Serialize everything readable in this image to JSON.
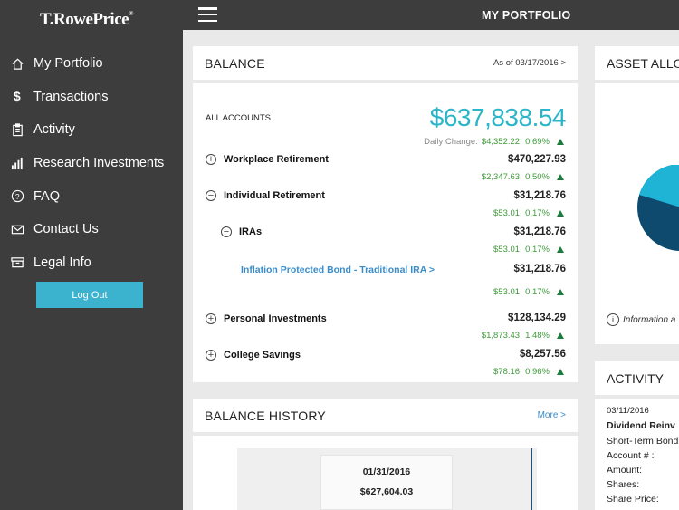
{
  "brand": {
    "name": "T.RowePrice",
    "reg": "®"
  },
  "header": {
    "title": "MY PORTFOLIO"
  },
  "sidebar": {
    "items": [
      {
        "label": "My Portfolio",
        "icon": "home-icon"
      },
      {
        "label": "Transactions",
        "icon": "dollar-icon"
      },
      {
        "label": "Activity",
        "icon": "clipboard-icon"
      },
      {
        "label": "Research Investments",
        "icon": "bar-chart-icon"
      },
      {
        "label": "FAQ",
        "icon": "question-icon"
      },
      {
        "label": "Contact Us",
        "icon": "mail-icon"
      },
      {
        "label": "Legal Info",
        "icon": "archive-icon"
      }
    ],
    "logout_label": "Log Out"
  },
  "balance": {
    "title": "BALANCE",
    "as_of": "As of 03/17/2016 >",
    "all_accounts_label": "ALL ACCOUNTS",
    "total": "$637,838.54",
    "daily_change_label": "Daily Change:",
    "daily_change_value": "$4,352.22",
    "daily_change_pct": "0.69%",
    "rows": [
      {
        "label": "Workplace Retirement",
        "toggle": "+",
        "amount": "$470,227.93",
        "change": "$2,347.63",
        "pct": "0.50%"
      },
      {
        "label": "Individual Retirement",
        "toggle": "−",
        "amount": "$31,218.76",
        "change": "$53.01",
        "pct": "0.17%"
      },
      {
        "label": "IRAs",
        "toggle": "−",
        "amount": "$31,218.76",
        "change": "$53.01",
        "pct": "0.17%"
      },
      {
        "label": "Inflation Protected Bond - Traditional IRA  >",
        "amount": "$31,218.76",
        "change": "$53.01",
        "pct": "0.17%"
      },
      {
        "label": "Personal Investments",
        "toggle": "+",
        "amount": "$128,134.29",
        "change": "$1,873.43",
        "pct": "1.48%"
      },
      {
        "label": "College Savings",
        "toggle": "+",
        "amount": "$8,257.56",
        "change": "$78.16",
        "pct": "0.96%"
      }
    ]
  },
  "balance_history": {
    "title": "BALANCE HISTORY",
    "more": "More >",
    "tooltip_date": "01/31/2016",
    "tooltip_value": "$627,604.03"
  },
  "asset_allocation": {
    "title": "ASSET ALLO",
    "info": "Information a",
    "colors": {
      "dark": "#0e4a6e",
      "light": "#1fb3d6",
      "mid": "#39647f"
    }
  },
  "activity": {
    "title": "ACTIVITY",
    "date": "03/11/2016",
    "name": "Dividend Reinv",
    "fund": "Short-Term Bond",
    "fields": [
      "Account # :",
      "Amount:",
      "Shares:",
      "Share Price:"
    ]
  }
}
